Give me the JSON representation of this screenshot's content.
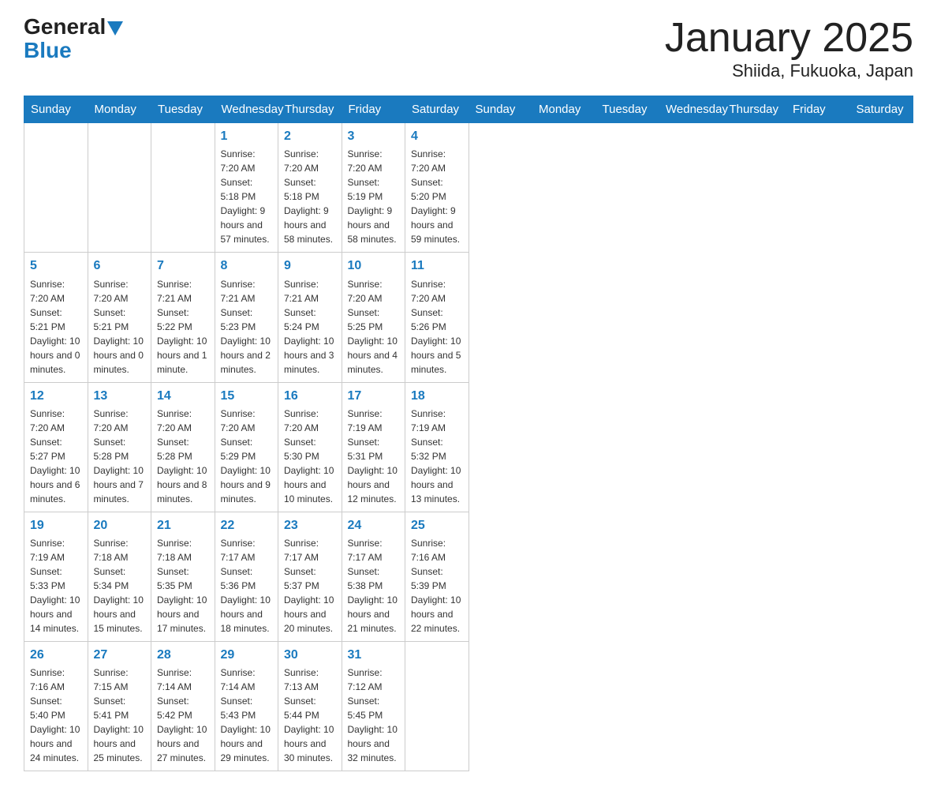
{
  "header": {
    "logo_general": "General",
    "logo_blue": "Blue",
    "month": "January 2025",
    "location": "Shiida, Fukuoka, Japan"
  },
  "days_of_week": [
    "Sunday",
    "Monday",
    "Tuesday",
    "Wednesday",
    "Thursday",
    "Friday",
    "Saturday"
  ],
  "weeks": [
    [
      null,
      null,
      null,
      {
        "day": "1",
        "sunrise": "Sunrise: 7:20 AM",
        "sunset": "Sunset: 5:18 PM",
        "daylight": "Daylight: 9 hours and 57 minutes."
      },
      {
        "day": "2",
        "sunrise": "Sunrise: 7:20 AM",
        "sunset": "Sunset: 5:18 PM",
        "daylight": "Daylight: 9 hours and 58 minutes."
      },
      {
        "day": "3",
        "sunrise": "Sunrise: 7:20 AM",
        "sunset": "Sunset: 5:19 PM",
        "daylight": "Daylight: 9 hours and 58 minutes."
      },
      {
        "day": "4",
        "sunrise": "Sunrise: 7:20 AM",
        "sunset": "Sunset: 5:20 PM",
        "daylight": "Daylight: 9 hours and 59 minutes."
      }
    ],
    [
      {
        "day": "5",
        "sunrise": "Sunrise: 7:20 AM",
        "sunset": "Sunset: 5:21 PM",
        "daylight": "Daylight: 10 hours and 0 minutes."
      },
      {
        "day": "6",
        "sunrise": "Sunrise: 7:20 AM",
        "sunset": "Sunset: 5:21 PM",
        "daylight": "Daylight: 10 hours and 0 minutes."
      },
      {
        "day": "7",
        "sunrise": "Sunrise: 7:21 AM",
        "sunset": "Sunset: 5:22 PM",
        "daylight": "Daylight: 10 hours and 1 minute."
      },
      {
        "day": "8",
        "sunrise": "Sunrise: 7:21 AM",
        "sunset": "Sunset: 5:23 PM",
        "daylight": "Daylight: 10 hours and 2 minutes."
      },
      {
        "day": "9",
        "sunrise": "Sunrise: 7:21 AM",
        "sunset": "Sunset: 5:24 PM",
        "daylight": "Daylight: 10 hours and 3 minutes."
      },
      {
        "day": "10",
        "sunrise": "Sunrise: 7:20 AM",
        "sunset": "Sunset: 5:25 PM",
        "daylight": "Daylight: 10 hours and 4 minutes."
      },
      {
        "day": "11",
        "sunrise": "Sunrise: 7:20 AM",
        "sunset": "Sunset: 5:26 PM",
        "daylight": "Daylight: 10 hours and 5 minutes."
      }
    ],
    [
      {
        "day": "12",
        "sunrise": "Sunrise: 7:20 AM",
        "sunset": "Sunset: 5:27 PM",
        "daylight": "Daylight: 10 hours and 6 minutes."
      },
      {
        "day": "13",
        "sunrise": "Sunrise: 7:20 AM",
        "sunset": "Sunset: 5:28 PM",
        "daylight": "Daylight: 10 hours and 7 minutes."
      },
      {
        "day": "14",
        "sunrise": "Sunrise: 7:20 AM",
        "sunset": "Sunset: 5:28 PM",
        "daylight": "Daylight: 10 hours and 8 minutes."
      },
      {
        "day": "15",
        "sunrise": "Sunrise: 7:20 AM",
        "sunset": "Sunset: 5:29 PM",
        "daylight": "Daylight: 10 hours and 9 minutes."
      },
      {
        "day": "16",
        "sunrise": "Sunrise: 7:20 AM",
        "sunset": "Sunset: 5:30 PM",
        "daylight": "Daylight: 10 hours and 10 minutes."
      },
      {
        "day": "17",
        "sunrise": "Sunrise: 7:19 AM",
        "sunset": "Sunset: 5:31 PM",
        "daylight": "Daylight: 10 hours and 12 minutes."
      },
      {
        "day": "18",
        "sunrise": "Sunrise: 7:19 AM",
        "sunset": "Sunset: 5:32 PM",
        "daylight": "Daylight: 10 hours and 13 minutes."
      }
    ],
    [
      {
        "day": "19",
        "sunrise": "Sunrise: 7:19 AM",
        "sunset": "Sunset: 5:33 PM",
        "daylight": "Daylight: 10 hours and 14 minutes."
      },
      {
        "day": "20",
        "sunrise": "Sunrise: 7:18 AM",
        "sunset": "Sunset: 5:34 PM",
        "daylight": "Daylight: 10 hours and 15 minutes."
      },
      {
        "day": "21",
        "sunrise": "Sunrise: 7:18 AM",
        "sunset": "Sunset: 5:35 PM",
        "daylight": "Daylight: 10 hours and 17 minutes."
      },
      {
        "day": "22",
        "sunrise": "Sunrise: 7:17 AM",
        "sunset": "Sunset: 5:36 PM",
        "daylight": "Daylight: 10 hours and 18 minutes."
      },
      {
        "day": "23",
        "sunrise": "Sunrise: 7:17 AM",
        "sunset": "Sunset: 5:37 PM",
        "daylight": "Daylight: 10 hours and 20 minutes."
      },
      {
        "day": "24",
        "sunrise": "Sunrise: 7:17 AM",
        "sunset": "Sunset: 5:38 PM",
        "daylight": "Daylight: 10 hours and 21 minutes."
      },
      {
        "day": "25",
        "sunrise": "Sunrise: 7:16 AM",
        "sunset": "Sunset: 5:39 PM",
        "daylight": "Daylight: 10 hours and 22 minutes."
      }
    ],
    [
      {
        "day": "26",
        "sunrise": "Sunrise: 7:16 AM",
        "sunset": "Sunset: 5:40 PM",
        "daylight": "Daylight: 10 hours and 24 minutes."
      },
      {
        "day": "27",
        "sunrise": "Sunrise: 7:15 AM",
        "sunset": "Sunset: 5:41 PM",
        "daylight": "Daylight: 10 hours and 25 minutes."
      },
      {
        "day": "28",
        "sunrise": "Sunrise: 7:14 AM",
        "sunset": "Sunset: 5:42 PM",
        "daylight": "Daylight: 10 hours and 27 minutes."
      },
      {
        "day": "29",
        "sunrise": "Sunrise: 7:14 AM",
        "sunset": "Sunset: 5:43 PM",
        "daylight": "Daylight: 10 hours and 29 minutes."
      },
      {
        "day": "30",
        "sunrise": "Sunrise: 7:13 AM",
        "sunset": "Sunset: 5:44 PM",
        "daylight": "Daylight: 10 hours and 30 minutes."
      },
      {
        "day": "31",
        "sunrise": "Sunrise: 7:12 AM",
        "sunset": "Sunset: 5:45 PM",
        "daylight": "Daylight: 10 hours and 32 minutes."
      },
      null
    ]
  ]
}
